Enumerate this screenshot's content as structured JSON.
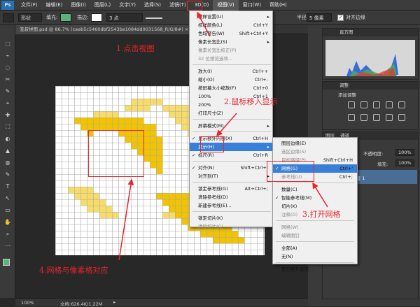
{
  "app": {
    "logo": "Ps"
  },
  "menubar": {
    "items": [
      "文件(F)",
      "编辑(E)",
      "图像(I)",
      "图层(L)",
      "文字(Y)",
      "选择(S)",
      "滤镜(T)",
      "3D(D)",
      "视图(V)",
      "窗口(W)",
      "帮助(H)"
    ],
    "active_index": 8
  },
  "options": {
    "shape_mode": "形状",
    "fill_label": "填充:",
    "stroke_label": "描边:",
    "stroke_width": "3 点",
    "radius_label": "半径:",
    "radius_value": "5 像素",
    "align_edges": "对齐边缘"
  },
  "document": {
    "tab_title": "笼叔拼图.psd @ 86.7% (caeb5c5460dbf2543be1084dd0031568_R/G/8#)",
    "zoom": "100%",
    "doc_size": "文档:626.4K/1.22M"
  },
  "view_menu": {
    "items": [
      {
        "label": "校样设置(U)",
        "shortcut": "",
        "submenu": true
      },
      {
        "label": "校样颜色(L)",
        "shortcut": "Ctrl+Y"
      },
      {
        "label": "色域警告(W)",
        "shortcut": "Shift+Ctrl+Y"
      },
      {
        "label": "像素长宽比(S)",
        "shortcut": "",
        "submenu": true
      },
      {
        "label": "像素长宽比校正(P)",
        "shortcut": "",
        "disabled": true
      },
      {
        "label": "32 位预览选项...",
        "shortcut": "",
        "disabled": true
      },
      {
        "label": "放大(I)",
        "shortcut": "Ctrl++"
      },
      {
        "label": "缩小(O)",
        "shortcut": "Ctrl+-"
      },
      {
        "label": "按屏幕大小缩放(F)",
        "shortcut": "Ctrl+0"
      },
      {
        "label": "100%",
        "shortcut": "Ctrl+1"
      },
      {
        "label": "200%",
        "shortcut": ""
      },
      {
        "label": "打印尺寸(Z)",
        "shortcut": ""
      },
      {
        "label": "屏幕模式(M)",
        "shortcut": "",
        "submenu": true
      },
      {
        "label": "显示额外内容(X)",
        "shortcut": "Ctrl+H",
        "checked": true
      },
      {
        "label": "显示(H)",
        "shortcut": "",
        "submenu": true,
        "highlighted": true
      },
      {
        "label": "标尺(R)",
        "shortcut": "Ctrl+R",
        "checked": true
      },
      {
        "label": "对齐(N)",
        "shortcut": "Shift+Ctrl+;",
        "checked": true
      },
      {
        "label": "对齐到(T)",
        "shortcut": "",
        "submenu": true
      },
      {
        "label": "锁定参考线(G)",
        "shortcut": "Alt+Ctrl+;"
      },
      {
        "label": "清除参考线(D)",
        "shortcut": ""
      },
      {
        "label": "新建参考线(E)...",
        "shortcut": ""
      },
      {
        "label": "锁定切片(K)",
        "shortcut": ""
      },
      {
        "label": "清除切片(C)",
        "shortcut": "",
        "disabled": true
      }
    ]
  },
  "show_menu": {
    "items": [
      {
        "label": "图层边缘(E)",
        "shortcut": ""
      },
      {
        "label": "选区边缘(S)",
        "shortcut": "",
        "disabled": true
      },
      {
        "label": "目标路径(P)",
        "shortcut": "Shift+Ctrl+H",
        "disabled": true
      },
      {
        "label": "网格(G)",
        "shortcut": "Ctrl+'",
        "checked": true,
        "highlighted": true
      },
      {
        "label": "参考线(U)",
        "shortcut": "Ctrl+;",
        "disabled": true
      },
      {
        "label": "数量(C)",
        "shortcut": ""
      },
      {
        "label": "智能参考线(M)",
        "shortcut": "",
        "checked": true
      },
      {
        "label": "切片(K)",
        "shortcut": ""
      },
      {
        "label": "注释(O)",
        "shortcut": "",
        "disabled": true
      },
      {
        "label": "网格(W)",
        "shortcut": "",
        "disabled": true
      },
      {
        "label": "编辑图钉",
        "shortcut": "",
        "disabled": true
      },
      {
        "label": "全部(A)",
        "shortcut": ""
      },
      {
        "label": "无(N)",
        "shortcut": ""
      },
      {
        "label": "显示额外选项...",
        "shortcut": ""
      }
    ]
  },
  "panels": {
    "histogram_title": "直方图",
    "adjust_tab": "调整",
    "adjust_add": "添加调整",
    "layers_tab": "图层",
    "channels_tab": "通道",
    "opacity_label": "不透明度:",
    "opacity_value": "100%",
    "fill_label": "填充:",
    "fill_value": "100%",
    "layer_name": "图层 1"
  },
  "annotations": {
    "step1": "1.点击视图",
    "step2": "2.鼠标移入显示",
    "step3": "3.打开网格",
    "step4": "4.网格与像素格对应"
  },
  "colors": {
    "accent": "#e8252b",
    "menu_highlight": "#3a7fd7",
    "pixel_yellow": "#f2c300",
    "pixel_light": "#f7dc6a",
    "fill_swatch": "#5ab37b"
  }
}
